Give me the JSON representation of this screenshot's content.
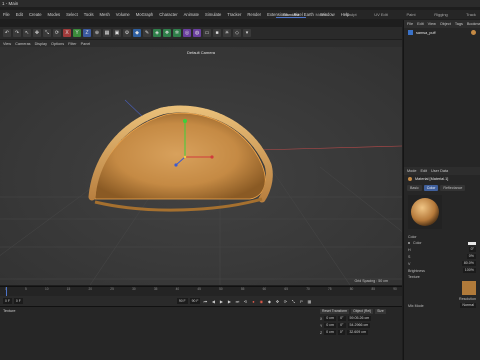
{
  "window": {
    "title": "1 - Main"
  },
  "menu": [
    "File",
    "Edit",
    "Create",
    "Modes",
    "Select",
    "Tools",
    "Mesh",
    "Volume",
    "MoGraph",
    "Character",
    "Animate",
    "Simulate",
    "Tracker",
    "Render",
    "Extensions",
    "Pixel Earth",
    "Window",
    "Help"
  ],
  "layouts": [
    {
      "label": "Standard",
      "active": true
    },
    {
      "label": "Model",
      "active": false
    },
    {
      "label": "Sculpt",
      "active": false
    },
    {
      "label": "UV Edit",
      "active": false
    },
    {
      "label": "Paint",
      "active": false
    },
    {
      "label": "Rigging",
      "active": false
    },
    {
      "label": "Track",
      "active": false
    }
  ],
  "toolbar_icons": [
    {
      "name": "undo-icon",
      "glyph": "↶",
      "color": "#3a3a3a"
    },
    {
      "name": "redo-icon",
      "glyph": "↷",
      "color": "#3a3a3a"
    },
    {
      "name": "live-selection-icon",
      "glyph": "↖",
      "color": "#3a3a3a"
    },
    {
      "name": "move-icon",
      "glyph": "✥",
      "color": "#3a3a3a"
    },
    {
      "name": "scale-icon",
      "glyph": "⤡",
      "color": "#3a3a3a"
    },
    {
      "name": "rotate-icon",
      "glyph": "⟳",
      "color": "#3a3a3a"
    },
    {
      "name": "x-axis-icon",
      "glyph": "X",
      "color": "#a03b3b"
    },
    {
      "name": "y-axis-icon",
      "glyph": "Y",
      "color": "#3b8a3b"
    },
    {
      "name": "z-axis-icon",
      "glyph": "Z",
      "color": "#3b5aa0"
    },
    {
      "name": "coordinate-system-icon",
      "glyph": "⊕",
      "color": "#3a3a3a"
    },
    {
      "name": "render-view-icon",
      "glyph": "▦",
      "color": "#3a3a3a"
    },
    {
      "name": "render-picture-viewer-icon",
      "glyph": "▣",
      "color": "#3a3a3a"
    },
    {
      "name": "render-settings-icon",
      "glyph": "⚙",
      "color": "#3a3a3a"
    },
    {
      "name": "cube-icon",
      "glyph": "◆",
      "color": "#2f5fa0"
    },
    {
      "name": "spline-pen-icon",
      "glyph": "✎",
      "color": "#3a3a3a"
    },
    {
      "name": "subdivision-icon",
      "glyph": "◈",
      "color": "#2f7f4a"
    },
    {
      "name": "array-icon",
      "glyph": "❖",
      "color": "#2f7f4a"
    },
    {
      "name": "cloner-icon",
      "glyph": "✲",
      "color": "#2f7f4a"
    },
    {
      "name": "deformer-icon",
      "glyph": "◎",
      "color": "#6a3fa0"
    },
    {
      "name": "field-icon",
      "glyph": "◍",
      "color": "#6a3fa0"
    },
    {
      "name": "floor-icon",
      "glyph": "▭",
      "color": "#3a3a3a"
    },
    {
      "name": "camera-icon",
      "glyph": "■",
      "color": "#3a3a3a"
    },
    {
      "name": "light-icon",
      "glyph": "☀",
      "color": "#3a3a3a"
    },
    {
      "name": "tag-icon",
      "glyph": "◇",
      "color": "#3a3a3a"
    },
    {
      "name": "more-icon",
      "glyph": "▾",
      "color": "#3a3a3a"
    }
  ],
  "viewport": {
    "menu": [
      "View",
      "Cameras",
      "Display",
      "Options",
      "Filter",
      "Panel"
    ],
    "camera_label": "Default Camera",
    "grid_spacing": "Grid Spacing : 50 cm"
  },
  "right_panel": {
    "top_tabs": [
      "File",
      "Edit",
      "View",
      "Object",
      "Tags",
      "Bookmarks"
    ],
    "object_name": "samsa_puff",
    "attr_tabs": [
      "Mode",
      "Edit",
      "User Data"
    ],
    "material_header": "Material [Material.1]",
    "material_tabs": [
      {
        "label": "Basic",
        "active": false
      },
      {
        "label": "Color",
        "active": true
      },
      {
        "label": "Reflectance",
        "active": false
      }
    ],
    "section": "Color",
    "color_label": "Color",
    "color_values": [
      {
        "axis": "H",
        "value": "0°"
      },
      {
        "axis": "S",
        "value": "0%"
      },
      {
        "axis": "V",
        "value": "80.0%"
      }
    ],
    "brightness_label": "Brightness",
    "brightness_value": "100%",
    "texture_label": "Texture",
    "resolution_label": "Resolution",
    "mix_mode_label": "Mix Mode",
    "mix_mode_value": "Normal"
  },
  "timeline": {
    "ticks": [
      "0",
      "5",
      "10",
      "15",
      "20",
      "25",
      "30",
      "35",
      "40",
      "45",
      "50",
      "55",
      "60",
      "65",
      "70",
      "75",
      "80",
      "85",
      "90"
    ],
    "current_frame": "0 F",
    "start_frame": "0 F",
    "end_frame": "90 F",
    "fps_field": "90 F"
  },
  "bottom": {
    "tab_label": "Texture",
    "coords_buttons": [
      "Reset Transform",
      "Object (Rel)",
      "Size"
    ],
    "coords": [
      {
        "axis": "X",
        "pos": "0 cm",
        "rot": "0°",
        "size": "59.05.26 cm"
      },
      {
        "axis": "Y",
        "pos": "0 cm",
        "rot": "0°",
        "size": "54.2966 cm"
      },
      {
        "axis": "Z",
        "pos": "0 cm",
        "rot": "0°",
        "size": "32.609 cm"
      }
    ]
  }
}
